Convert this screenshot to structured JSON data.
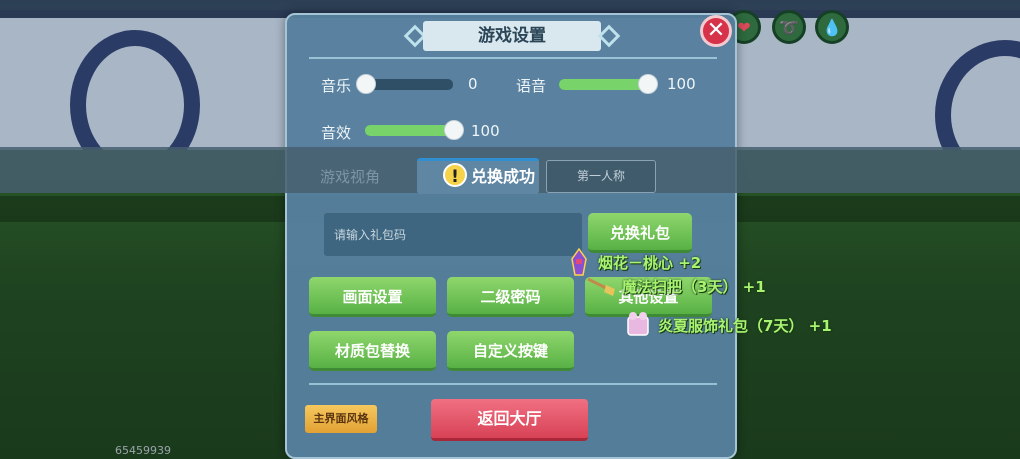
{
  "panel": {
    "title": "游戏设置",
    "close_symbol": "✕"
  },
  "audio": {
    "music_label": "音乐",
    "music_value": "0",
    "voice_label": "语音",
    "voice_value": "100",
    "sfx_label": "音效",
    "sfx_value": "100"
  },
  "view": {
    "label": "游戏视角",
    "option_first_person": "第一人称"
  },
  "toast": {
    "icon": "!",
    "text": "兑换成功"
  },
  "gift": {
    "placeholder": "请输入礼包码",
    "redeem_label": "兑换礼包"
  },
  "buttons": {
    "graphics": "画面设置",
    "secondary_password": "二级密码",
    "other": "其他设置",
    "texture_pack": "材质包替换",
    "custom_keys": "自定义按键",
    "main_style": "主界面风格",
    "back_lobby": "返回大厅"
  },
  "rewards": [
    {
      "icon": "firework-icon",
      "text": "烟花－桃心 +2"
    },
    {
      "icon": "broom-icon",
      "text": "魔法扫把（3天） +1"
    },
    {
      "icon": "costume-icon",
      "text": "炎夏服饰礼包（7天） +1"
    }
  ],
  "hud": {
    "icons": [
      "heart-icon",
      "stamina-icon",
      "water-icon"
    ]
  },
  "build_number": "65459939",
  "colors": {
    "panel": "#56809e",
    "green_button": "#6cc356",
    "slider_fill": "#77d36a",
    "close_button": "#d6324a",
    "lobby_button": "#e0566a",
    "style_button": "#f0b84e",
    "reward_text": "#a8f472"
  }
}
